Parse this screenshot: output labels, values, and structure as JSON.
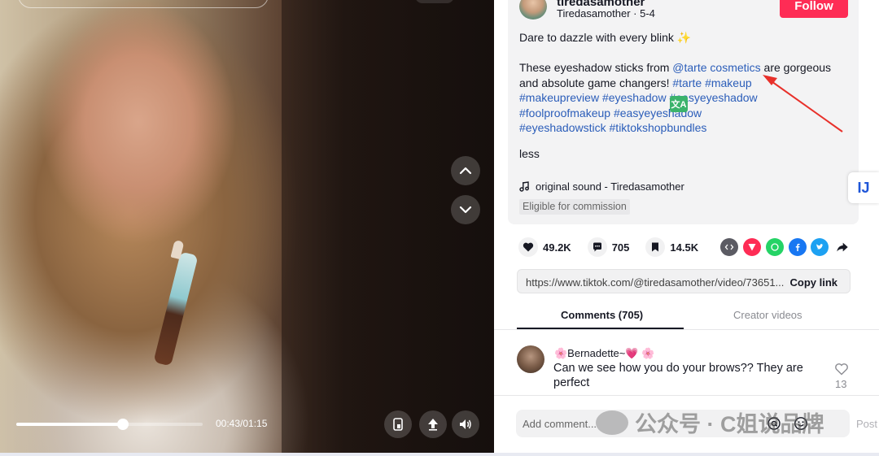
{
  "video": {
    "time_current": "00:43",
    "time_total": "01:15",
    "time_display": "00:43/01:15",
    "progress_fraction": 0.57
  },
  "post": {
    "username": "tiredasamother",
    "subline": "Tiredasamother · 5-4",
    "follow_label": "Follow",
    "caption_line1": "Dare to dazzle with every blink ✨",
    "caption_part_a": "These eyeshadow sticks from ",
    "caption_mention": "@tarte cosmetics",
    "caption_part_b": " are gorgeous and absolute game changers! ",
    "hashtags": [
      "#tarte",
      "#makeup",
      "#makeupreview",
      "#eyeshadow",
      "#easyeyeshadow",
      "#foolproofmakeup",
      "#easyeyeshadow",
      "#eyeshadowstick",
      "#tiktokshopbundles"
    ],
    "less_label": "less",
    "sound": "original sound - Tiredasamother",
    "commission": "Eligible for commission",
    "translate_glyph": "文A"
  },
  "stats": {
    "likes": "49.2K",
    "comments": "705",
    "saves": "14.5K"
  },
  "share": {
    "url": "https://www.tiktok.com/@tiredasamother/video/73651...",
    "copy_label": "Copy link"
  },
  "tabs": {
    "comments_label": "Comments (705)",
    "creator_label": "Creator videos"
  },
  "comment": {
    "user": "🌸Bernadette~💗 🌸",
    "text": "Can we see how you do your brows?? They are perfect",
    "likes": "13"
  },
  "input": {
    "placeholder": "Add comment...",
    "post_label": "Post"
  },
  "watermark": {
    "text": "公众号 · C姐说品牌"
  },
  "side_badge": "IJ",
  "colors": {
    "accent_red": "#fe2c55",
    "link_blue": "#2b5db9",
    "text_dark": "#161823"
  }
}
